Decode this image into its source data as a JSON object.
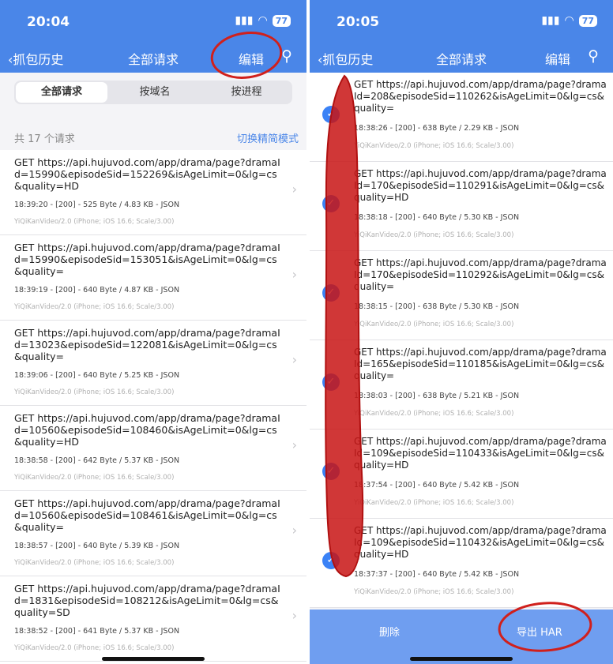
{
  "left": {
    "time": "20:04",
    "battery": "77",
    "back_label": "抓包历史",
    "title": "全部请求",
    "edit_label": "编辑",
    "segments": [
      "全部请求",
      "按域名",
      "按进程"
    ],
    "count_label": "共 17 个请求",
    "toggle_label": "切换精简模式",
    "items": [
      {
        "url": "GET https://api.hujuvod.com/app/drama/page?dramaId=15990&episodeSid=152269&isAgeLimit=0&lg=cs&quality=HD",
        "meta": "18:39:20 - [200] - 525 Byte / 4.83 KB - JSON",
        "ua": "YiQiKanVideo/2.0 (iPhone; iOS 16.6; Scale/3.00)"
      },
      {
        "url": "GET https://api.hujuvod.com/app/drama/page?dramaId=15990&episodeSid=153051&isAgeLimit=0&lg=cs&quality=",
        "meta": "18:39:19 - [200] - 640 Byte / 4.87 KB - JSON",
        "ua": "YiQiKanVideo/2.0 (iPhone; iOS 16.6; Scale/3.00)"
      },
      {
        "url": "GET https://api.hujuvod.com/app/drama/page?dramaId=13023&episodeSid=122081&isAgeLimit=0&lg=cs&quality=",
        "meta": "18:39:06 - [200] - 640 Byte / 5.25 KB - JSON",
        "ua": "YiQiKanVideo/2.0 (iPhone; iOS 16.6; Scale/3.00)"
      },
      {
        "url": "GET https://api.hujuvod.com/app/drama/page?dramaId=10560&episodeSid=108460&isAgeLimit=0&lg=cs&quality=HD",
        "meta": "18:38:58 - [200] - 642 Byte / 5.37 KB - JSON",
        "ua": "YiQiKanVideo/2.0 (iPhone; iOS 16.6; Scale/3.00)"
      },
      {
        "url": "GET https://api.hujuvod.com/app/drama/page?dramaId=10560&episodeSid=108461&isAgeLimit=0&lg=cs&quality=",
        "meta": "18:38:57 - [200] - 640 Byte / 5.39 KB - JSON",
        "ua": "YiQiKanVideo/2.0 (iPhone; iOS 16.6; Scale/3.00)"
      },
      {
        "url": "GET https://api.hujuvod.com/app/drama/page?dramaId=1831&episodeSid=108212&isAgeLimit=0&lg=cs&quality=SD",
        "meta": "18:38:52 - [200] - 641 Byte / 5.37 KB - JSON",
        "ua": "YiQiKanVideo/2.0 (iPhone; iOS 16.6; Scale/3.00)"
      }
    ]
  },
  "right": {
    "time": "20:05",
    "battery": "77",
    "back_label": "抓包历史",
    "title": "全部请求",
    "edit_label": "编辑",
    "items": [
      {
        "url": "GET https://api.hujuvod.com/app/drama/page?dramaId=208&episodeSid=110262&isAgeLimit=0&lg=cs&quality=",
        "meta": "18:38:26 - [200] - 638 Byte / 2.29 KB - JSON",
        "ua": "YiQiKanVideo/2.0 (iPhone; iOS 16.6; Scale/3.00)"
      },
      {
        "url": "GET https://api.hujuvod.com/app/drama/page?dramaId=170&episodeSid=110291&isAgeLimit=0&lg=cs&quality=HD",
        "meta": "18:38:18 - [200] - 640 Byte / 5.30 KB - JSON",
        "ua": "YiQiKanVideo/2.0 (iPhone; iOS 16.6; Scale/3.00)"
      },
      {
        "url": "GET https://api.hujuvod.com/app/drama/page?dramaId=170&episodeSid=110292&isAgeLimit=0&lg=cs&quality=",
        "meta": "18:38:15 - [200] - 638 Byte / 5.30 KB - JSON",
        "ua": "YiQiKanVideo/2.0 (iPhone; iOS 16.6; Scale/3.00)"
      },
      {
        "url": "GET https://api.hujuvod.com/app/drama/page?dramaId=165&episodeSid=110185&isAgeLimit=0&lg=cs&quality=",
        "meta": "18:38:03 - [200] - 638 Byte / 5.21 KB - JSON",
        "ua": "YiQiKanVideo/2.0 (iPhone; iOS 16.6; Scale/3.00)"
      },
      {
        "url": "GET https://api.hujuvod.com/app/drama/page?dramaId=109&episodeSid=110433&isAgeLimit=0&lg=cs&quality=HD",
        "meta": "18:37:54 - [200] - 640 Byte / 5.42 KB - JSON",
        "ua": "YiQiKanVideo/2.0 (iPhone; iOS 16.6; Scale/3.00)"
      },
      {
        "url": "GET https://api.hujuvod.com/app/drama/page?dramaId=109&episodeSid=110432&isAgeLimit=0&lg=cs&quality=HD",
        "meta": "18:37:37 - [200] - 640 Byte / 5.42 KB - JSON",
        "ua": "YiQiKanVideo/2.0 (iPhone; iOS 16.6; Scale/3.00)"
      }
    ],
    "delete_label": "删除",
    "export_label": "导出 HAR"
  },
  "icons": {
    "check": "✓",
    "chevron": "›",
    "back": "‹",
    "search": "⚲",
    "wifi": "wifi-icon",
    "signal": "signal-icon"
  },
  "colors": {
    "header": "#4a86e8",
    "footer": "#6f9ef0",
    "check": "#3b82f6",
    "annotation": "#d0201c"
  }
}
